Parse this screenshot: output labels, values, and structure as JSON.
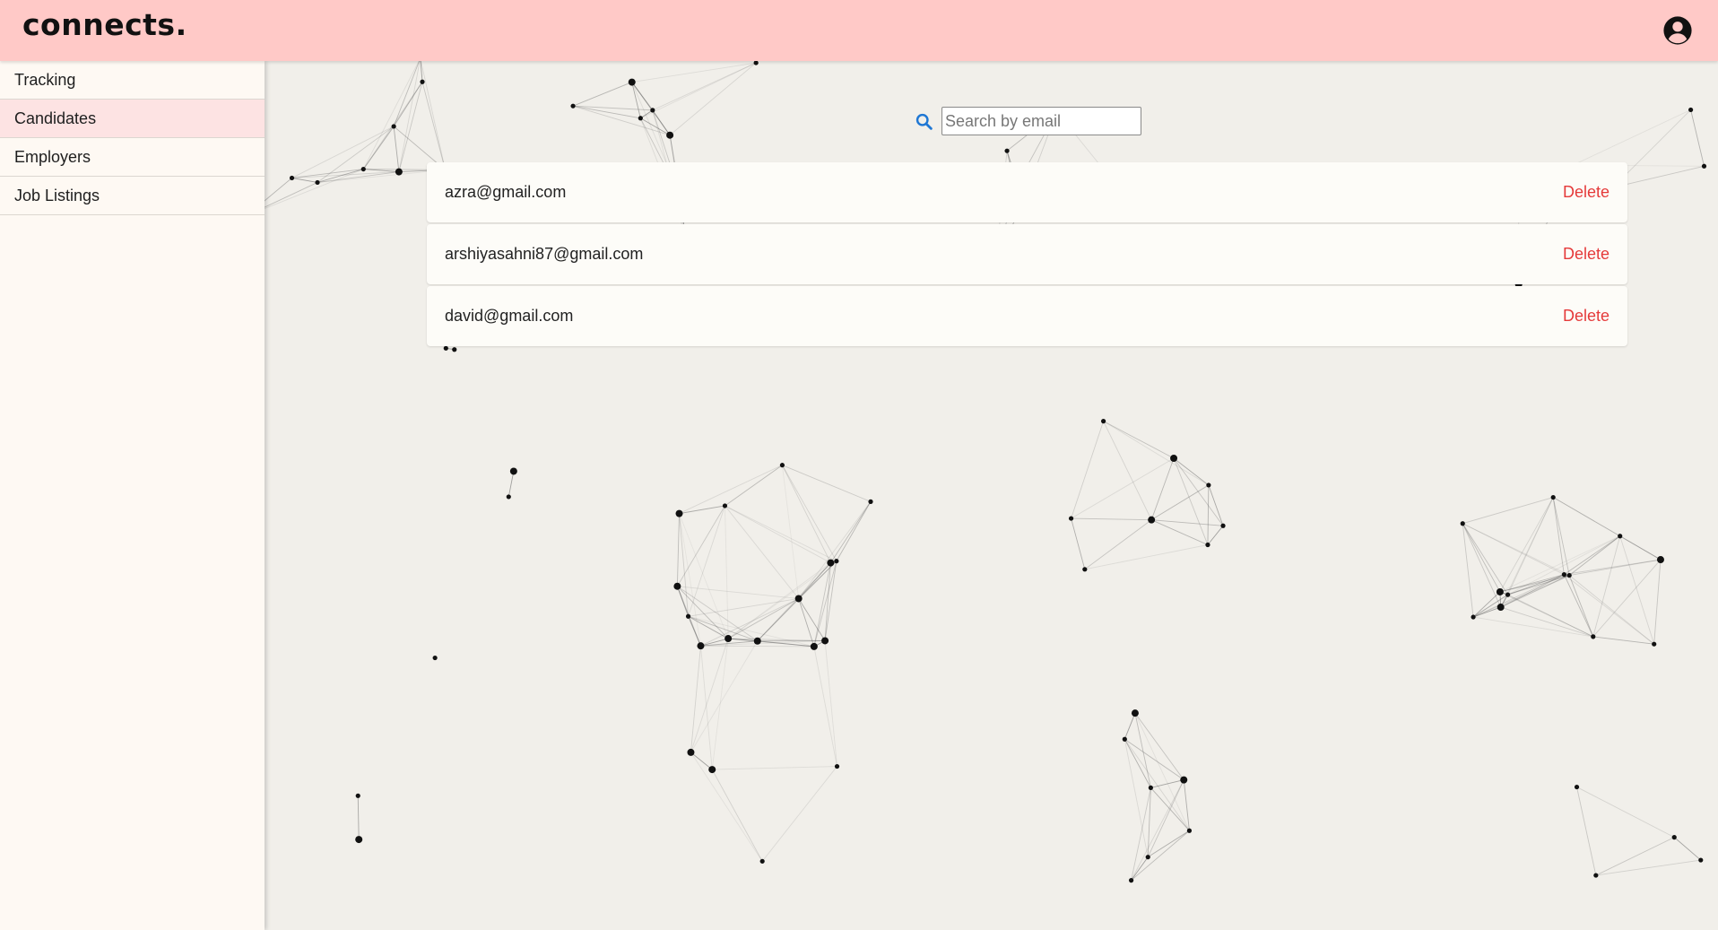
{
  "app": {
    "logo": "connects."
  },
  "header": {
    "account_icon": "account-circle-icon"
  },
  "sidebar": {
    "items": [
      {
        "label": "Tracking",
        "active": false
      },
      {
        "label": "Candidates",
        "active": true
      },
      {
        "label": "Employers",
        "active": false
      },
      {
        "label": "Job Listings",
        "active": false
      }
    ]
  },
  "search": {
    "placeholder": "Search by email",
    "value": "",
    "icon": "search-icon"
  },
  "candidates": [
    {
      "email": "azra@gmail.com",
      "action": "Delete"
    },
    {
      "email": "arshiyasahni87@gmail.com",
      "action": "Delete"
    },
    {
      "email": "david@gmail.com",
      "action": "Delete"
    }
  ],
  "colors": {
    "header_bg": "#ffc9c7",
    "sidebar_bg": "#fef9f3",
    "active_item_bg": "#fde3e3",
    "delete_text": "#e53a3a",
    "search_icon": "#1f77d4",
    "canvas_bg": "#f1efea"
  }
}
